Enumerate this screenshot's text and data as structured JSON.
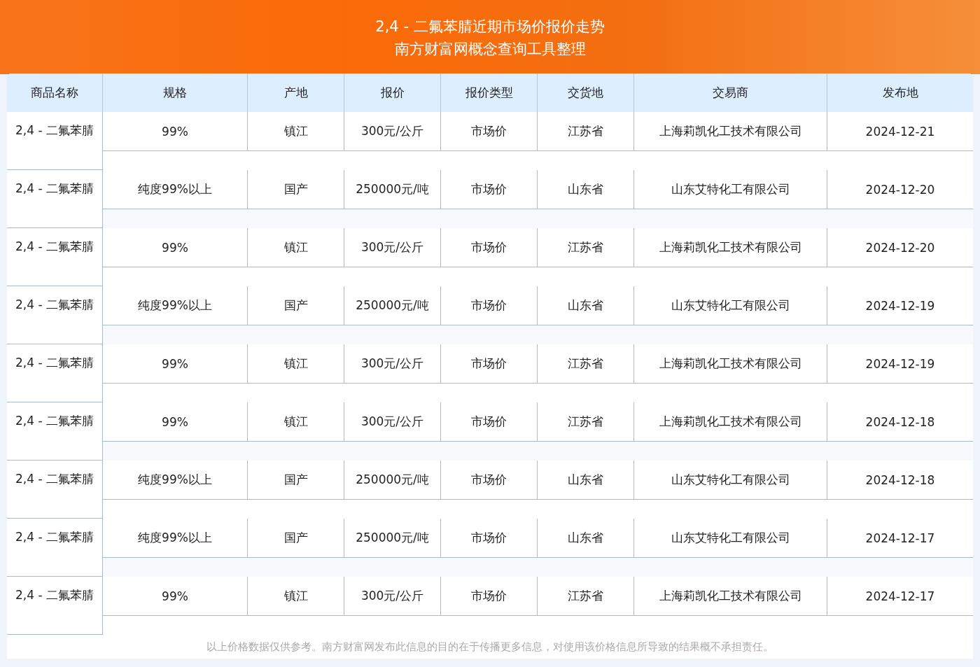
{
  "header": {
    "title": "2,4 - 二氟苯腈近期市场价报价走势",
    "subtitle": "南方财富网概念查询工具整理"
  },
  "table": {
    "columns": [
      "商品名称",
      "规格",
      "产地",
      "报价",
      "报价类型",
      "交货地",
      "交易商",
      "发布地"
    ],
    "rows": [
      [
        "2,4 - 二氟苯腈",
        "99%",
        "镇江",
        "300元/公斤",
        "市场价",
        "江苏省",
        "上海莉凯化工技术有限公司",
        "2024-12-21"
      ],
      [
        "2,4 - 二氟苯腈",
        "纯度99%以上",
        "国产",
        "250000元/吨",
        "市场价",
        "山东省",
        "山东艾特化工有限公司",
        "2024-12-20"
      ],
      [
        "2,4 - 二氟苯腈",
        "99%",
        "镇江",
        "300元/公斤",
        "市场价",
        "江苏省",
        "上海莉凯化工技术有限公司",
        "2024-12-20"
      ],
      [
        "2,4 - 二氟苯腈",
        "纯度99%以上",
        "国产",
        "250000元/吨",
        "市场价",
        "山东省",
        "山东艾特化工有限公司",
        "2024-12-19"
      ],
      [
        "2,4 - 二氟苯腈",
        "99%",
        "镇江",
        "300元/公斤",
        "市场价",
        "江苏省",
        "上海莉凯化工技术有限公司",
        "2024-12-19"
      ],
      [
        "2,4 - 二氟苯腈",
        "99%",
        "镇江",
        "300元/公斤",
        "市场价",
        "江苏省",
        "上海莉凯化工技术有限公司",
        "2024-12-18"
      ],
      [
        "2,4 - 二氟苯腈",
        "纯度99%以上",
        "国产",
        "250000元/吨",
        "市场价",
        "山东省",
        "山东艾特化工有限公司",
        "2024-12-18"
      ],
      [
        "2,4 - 二氟苯腈",
        "纯度99%以上",
        "国产",
        "250000元/吨",
        "市场价",
        "山东省",
        "山东艾特化工有限公司",
        "2024-12-17"
      ],
      [
        "2,4 - 二氟苯腈",
        "99%",
        "镇江",
        "300元/公斤",
        "市场价",
        "江苏省",
        "上海莉凯化工技术有限公司",
        "2024-12-17"
      ]
    ]
  },
  "footer": "以上价格数据仅供参考。南方财富网发布此信息的目的在于传播更多信息，对使用该价格信息所导致的结果概不承担责任。"
}
